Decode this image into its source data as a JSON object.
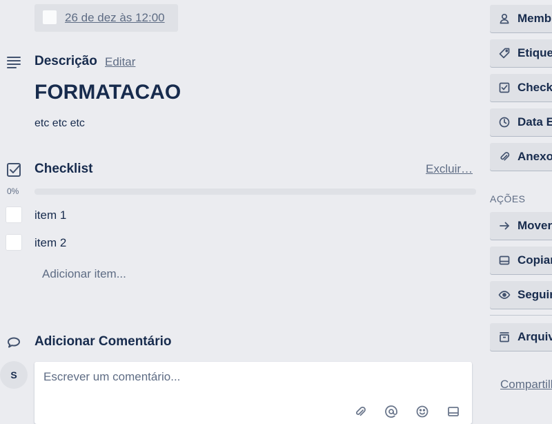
{
  "due_date": {
    "text": "26 de dez às 12:00",
    "completed": false
  },
  "description": {
    "title": "Descrição",
    "edit_label": "Editar",
    "heading": "FORMATACAO",
    "body": "etc etc etc"
  },
  "checklist": {
    "title": "Checklist",
    "delete_label": "Excluir…",
    "progress_label": "0%",
    "progress": 0,
    "items": [
      {
        "label": "item 1",
        "checked": false
      },
      {
        "label": "item 2",
        "checked": false
      }
    ],
    "add_item_label": "Adicionar item..."
  },
  "comment": {
    "title": "Adicionar Comentário",
    "avatar_initial": "S",
    "placeholder": "Escrever um comentário..."
  },
  "sidebar": {
    "add_items": [
      {
        "label": "Membros",
        "icon": "person-icon"
      },
      {
        "label": "Etiquetas",
        "icon": "tag-icon"
      },
      {
        "label": "Checklist",
        "icon": "checkbox-icon"
      },
      {
        "label": "Data Entrega",
        "icon": "clock-icon"
      },
      {
        "label": "Anexo",
        "icon": "paperclip-icon"
      }
    ],
    "actions_heading": "AÇÕES",
    "actions": [
      {
        "label": "Mover",
        "icon": "arrow-right-icon"
      },
      {
        "label": "Copiar",
        "icon": "card-icon"
      },
      {
        "label": "Seguir",
        "icon": "eye-icon"
      }
    ],
    "archive": {
      "label": "Arquivar",
      "icon": "archive-icon"
    },
    "share_label": "Compartilhar"
  },
  "colors": {
    "background": "#ebecf0",
    "button": "#dfe1e6",
    "text": "#172b4d",
    "muted": "#5e6c84"
  }
}
